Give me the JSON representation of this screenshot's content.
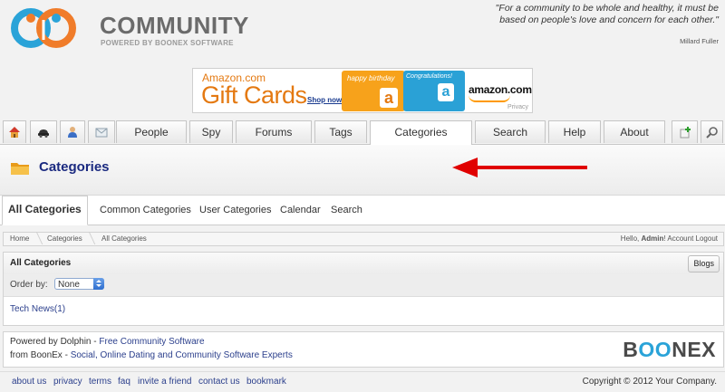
{
  "header": {
    "logo_title": "COMMUNITY",
    "logo_subtitle": "POWERED BY BOONEX SOFTWARE",
    "quote": "\"For a community to be whole and healthy, it must be based on people's love and concern for each other.\"",
    "quote_author": "Millard Fuller"
  },
  "ad": {
    "line1": "Amazon.com",
    "line2": "Gift Cards",
    "shop": "Shop now",
    "card1_text": "happy birthday",
    "card2_text": "Congratulations!",
    "brand": "amazon.com",
    "privacy": "Privacy"
  },
  "nav": {
    "tabs": [
      "People",
      "Spy",
      "Forums",
      "Tags",
      "Categories",
      "Search",
      "Help",
      "About"
    ],
    "active": "Categories"
  },
  "page": {
    "title": "Categories"
  },
  "subtabs": [
    "All Categories",
    "Common Categories",
    "User Categories",
    "Calendar",
    "Search"
  ],
  "breadcrumb": {
    "items": [
      "Home",
      "Categories",
      "All Categories"
    ],
    "welcome_prefix": "Hello,",
    "user": "Admin",
    "welcome_suffix": "!",
    "account": "Account",
    "logout": "Logout"
  },
  "box": {
    "title": "All Categories",
    "blogs_button": "Blogs",
    "order_label": "Order by:",
    "order_value": "None",
    "items": [
      "Tech News(1)"
    ]
  },
  "footer": {
    "line1_prefix": "Powered by Dolphin",
    "line1_link": "Free Community Software",
    "line2_prefix": "from BoonEx",
    "line2_link": "Social, Online Dating and Community Software Experts",
    "brand_b": "B",
    "brand_oo": "OO",
    "brand_nex": "NEX"
  },
  "bottom_links": [
    "about us",
    "privacy",
    "terms",
    "faq",
    "invite a friend",
    "contact us",
    "bookmark"
  ],
  "copyright": "Copyright © 2012 Your Company.",
  "colors": {
    "title_blue": "#1b2a80",
    "link_blue": "#2b3f8c",
    "arrow_red": "#e00000",
    "logo_blue": "#2aa3d8",
    "logo_orange": "#f07c2a"
  }
}
